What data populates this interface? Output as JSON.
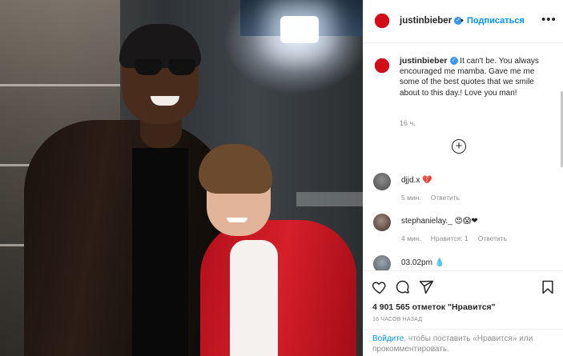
{
  "post": {
    "username": "justinbieber",
    "verified": true,
    "follow_label": "Подписаться",
    "more_label": "•••",
    "dot": "•",
    "caption_text": " It can't be. You always encouraged me mamba. Gave me me some of the best quotes that we smile about to this day.! Love you man!",
    "caption_time": "16 ч."
  },
  "comments": [
    {
      "user": "djjd.x",
      "text": " 💔",
      "time": "5 мин.",
      "reply_label": "Ответить"
    },
    {
      "user": "stephanielay._",
      "text": " 😍😱❤",
      "time": "4 мин.",
      "likes_label": "Нравится: 1",
      "reply_label": "Ответить"
    },
    {
      "user": "03.02pm",
      "text": " 💧"
    }
  ],
  "actions": {
    "likes_text": "4 901 565 отметок \"Нравится\"",
    "time_ago": "16 ЧАСОВ НАЗАД"
  },
  "login_prompt": {
    "link": "Войдите",
    "text": ", чтобы поставить «Нравится» или прокомментировать."
  },
  "icons": {
    "heart": "heart-icon",
    "comment": "comment-icon",
    "share": "share-icon",
    "save": "bookmark-icon",
    "add_comment": "add-circle-icon"
  },
  "colors": {
    "link_blue": "#0095f6",
    "verified_blue": "#3897f0",
    "avatar_red": "#d20d17",
    "text_primary": "#262626",
    "text_secondary": "#8e8e8e"
  }
}
